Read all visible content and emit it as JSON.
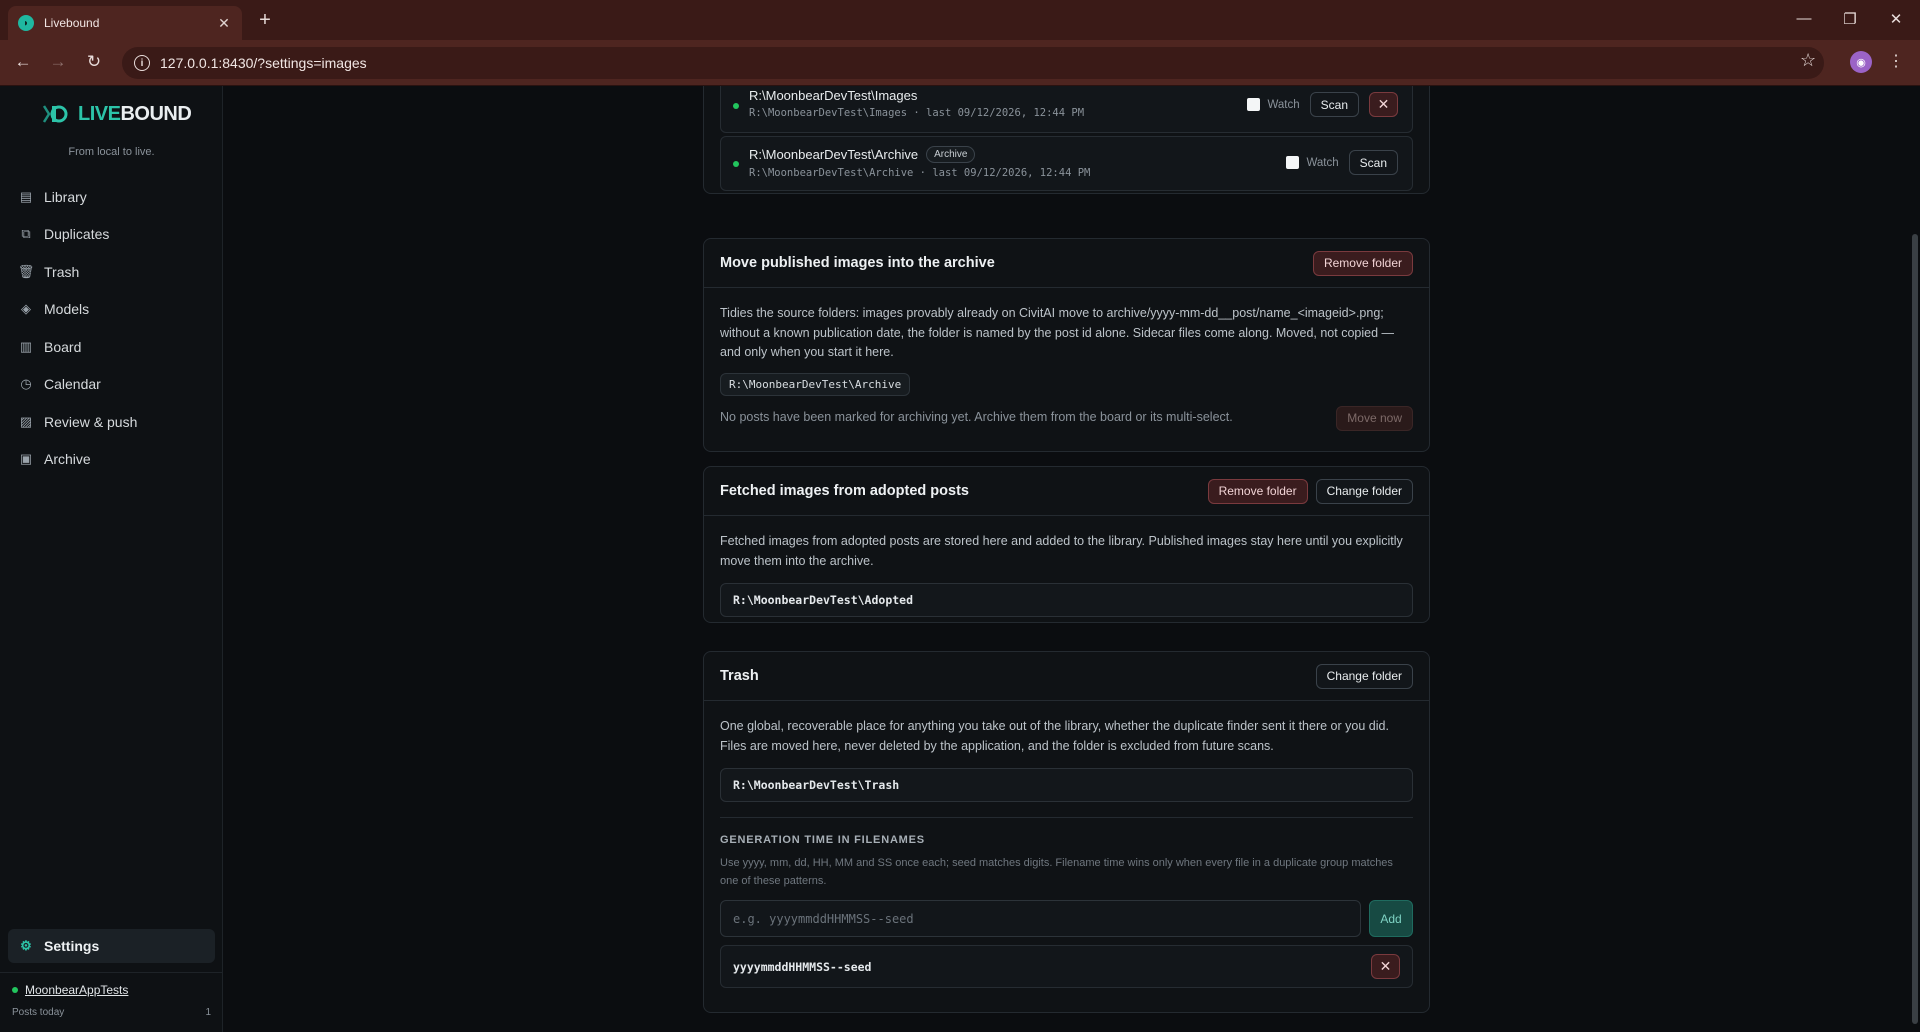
{
  "browser": {
    "tab_title": "Livebound",
    "url": "127.0.0.1:8430/?settings=images"
  },
  "sidebar": {
    "logo_text_a": "LIVE",
    "logo_text_b": "BOUND",
    "tagline": "From local to live.",
    "items": [
      {
        "label": "Library",
        "icon": "library-icon"
      },
      {
        "label": "Duplicates",
        "icon": "duplicates-icon"
      },
      {
        "label": "Trash",
        "icon": "trash-icon"
      },
      {
        "label": "Models",
        "icon": "models-icon"
      },
      {
        "label": "Board",
        "icon": "board-icon"
      },
      {
        "label": "Calendar",
        "icon": "calendar-icon"
      },
      {
        "label": "Review & push",
        "icon": "review-icon"
      },
      {
        "label": "Archive",
        "icon": "archive-icon"
      }
    ],
    "settings_label": "Settings",
    "account_name": "MoonbearAppTests",
    "posts_today_label": "Posts today",
    "posts_today_count": "1"
  },
  "sources": [
    {
      "title": "R:\\MoonbearDevTest\\Images",
      "subtitle": "R:\\MoonbearDevTest\\Images · last 09/12/2026, 12:44 PM",
      "watch_label": "Watch",
      "scan_label": "Scan"
    },
    {
      "title": "R:\\MoonbearDevTest\\Archive",
      "badge": "Archive",
      "subtitle": "R:\\MoonbearDevTest\\Archive · last 09/12/2026, 12:44 PM",
      "watch_label": "Watch",
      "scan_label": "Scan"
    }
  ],
  "archive_card": {
    "title": "Move published images into the archive",
    "remove_label": "Remove folder",
    "description": "Tidies the source folders: images provably already on CivitAI move to archive/yyyy-mm-dd__post/name_<imageid>.png; without a known publication date, the folder is named by the post id alone. Sidecar files come along. Moved, not copied — and only when you start it here.",
    "path": "R:\\MoonbearDevTest\\Archive",
    "status": "No posts have been marked for archiving yet. Archive them from the board or its multi-select.",
    "move_now_label": "Move now"
  },
  "adopted_card": {
    "title": "Fetched images from adopted posts",
    "remove_label": "Remove folder",
    "change_label": "Change folder",
    "description": "Fetched images from adopted posts are stored here and added to the library. Published images stay here until you explicitly move them into the archive.",
    "path": "R:\\MoonbearDevTest\\Adopted"
  },
  "trash_card": {
    "title": "Trash",
    "change_label": "Change folder",
    "description": "One global, recoverable place for anything you take out of the library, whether the duplicate finder sent it there or you did. Files are moved here, never deleted by the application, and the folder is excluded from future scans.",
    "path": "R:\\MoonbearDevTest\\Trash",
    "gen_time_label": "GENERATION TIME IN FILENAMES",
    "gen_time_hint": "Use yyyy, mm, dd, HH, MM and SS once each; seed matches digits. Filename time wins only when every file in a duplicate group matches one of these patterns.",
    "pattern_placeholder": "e.g. yyyymmddHHMMSS--seed",
    "add_label": "Add",
    "patterns": [
      "yyyymmddHHMMSS--seed"
    ]
  }
}
